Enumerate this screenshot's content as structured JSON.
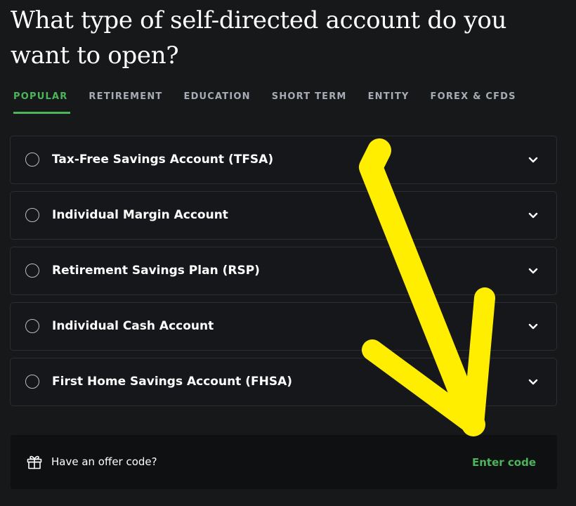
{
  "page": {
    "title": "What type of self-directed account do you want to open?"
  },
  "tabs": [
    {
      "label": "POPULAR",
      "active": true
    },
    {
      "label": "RETIREMENT",
      "active": false
    },
    {
      "label": "EDUCATION",
      "active": false
    },
    {
      "label": "SHORT TERM",
      "active": false
    },
    {
      "label": "ENTITY",
      "active": false
    },
    {
      "label": "FOREX & CFDS",
      "active": false
    }
  ],
  "accounts": [
    {
      "label": "Tax-Free Savings Account (TFSA)",
      "selected": false,
      "icon": "chevron-down-icon"
    },
    {
      "label": "Individual Margin Account",
      "selected": false,
      "icon": "chevron-down-icon"
    },
    {
      "label": "Retirement Savings Plan (RSP)",
      "selected": false,
      "icon": "chevron-down-icon"
    },
    {
      "label": "Individual Cash Account",
      "selected": false,
      "icon": "chevron-down-icon"
    },
    {
      "label": "First Home Savings Account (FHSA)",
      "selected": false,
      "icon": "chevron-down-icon"
    }
  ],
  "offer": {
    "icon": "gift-icon",
    "label": "Have an offer code?",
    "action_label": "Enter code"
  },
  "annotation": {
    "icon": "yellow-arrow-icon",
    "color": "#ffee00"
  },
  "colors": {
    "background": "#17181a",
    "accent": "#4cb55a",
    "tab_inactive": "#a7acb4",
    "card_border": "#2b2d31",
    "offer_background": "#0f1012"
  }
}
